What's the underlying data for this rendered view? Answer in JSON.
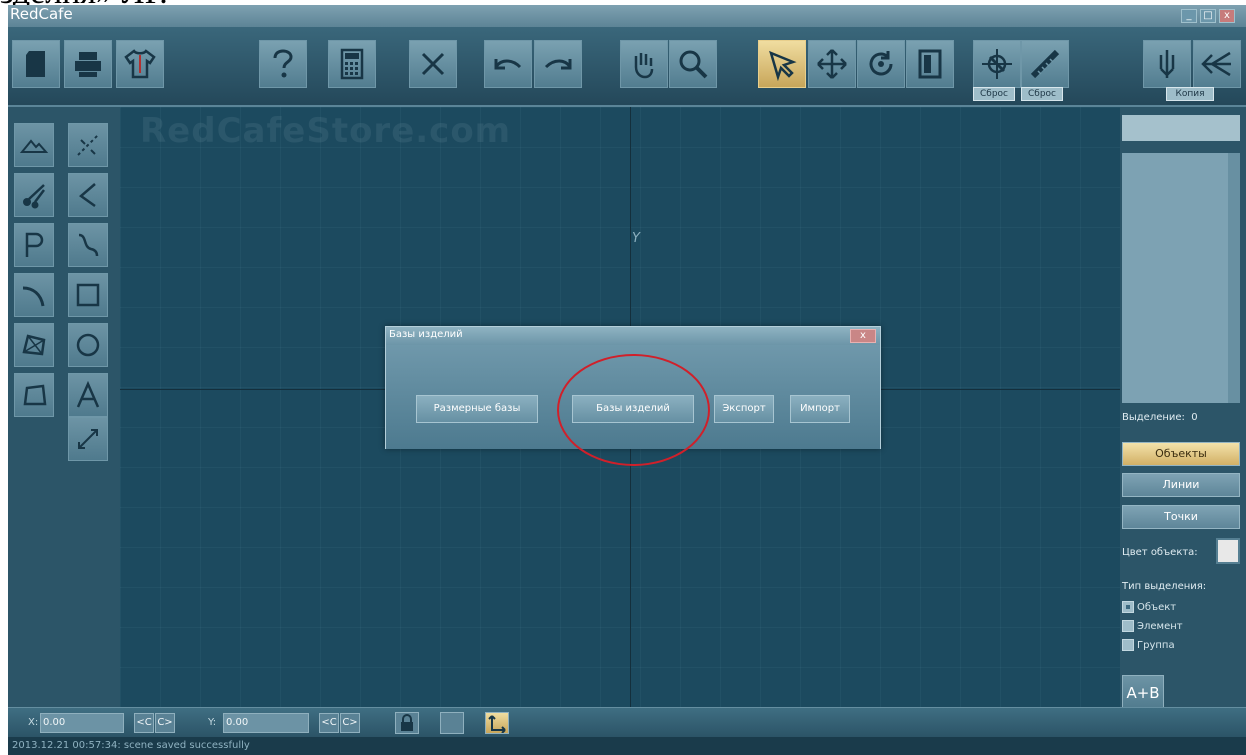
{
  "doc_text": "зделия» ЛР.",
  "window": {
    "title": "RedCafe",
    "controls": {
      "minimize": "_",
      "maximize": "□",
      "close": "x"
    }
  },
  "toolbar": {
    "reset1": "Сброс",
    "reset2": "Сброс",
    "copy": "Копия"
  },
  "canvas": {
    "watermark": "RedCafeStore.com",
    "y_axis_label": "Y"
  },
  "dialog": {
    "title": "Базы изделий",
    "close": "x",
    "buttons": [
      "Размерные базы",
      "Базы изделий",
      "Экспорт",
      "Импорт"
    ]
  },
  "right_panel": {
    "selection_label": "Выделение:",
    "selection_count": "0",
    "objects": "Объекты",
    "lines": "Линии",
    "points": "Точки",
    "object_color_label": "Цвет объекта:",
    "object_color": "#e8e8e8",
    "selection_type_label": "Тип выделения:",
    "selection_types": [
      "Объект",
      "Элемент",
      "Группа"
    ],
    "ab_button": "A+B"
  },
  "status": {
    "x_label": "X:",
    "x_value": "0.00",
    "y_label": "Y:",
    "y_value": "0.00",
    "prev": "<C",
    "next": "C>",
    "log": "2013.12.21 00:57:34: scene saved successfully"
  },
  "accent_colors": {
    "active": "#d7b46a",
    "panel": "#2c5568",
    "canvas": "#1c4a5f",
    "highlight": "#d0202a"
  }
}
